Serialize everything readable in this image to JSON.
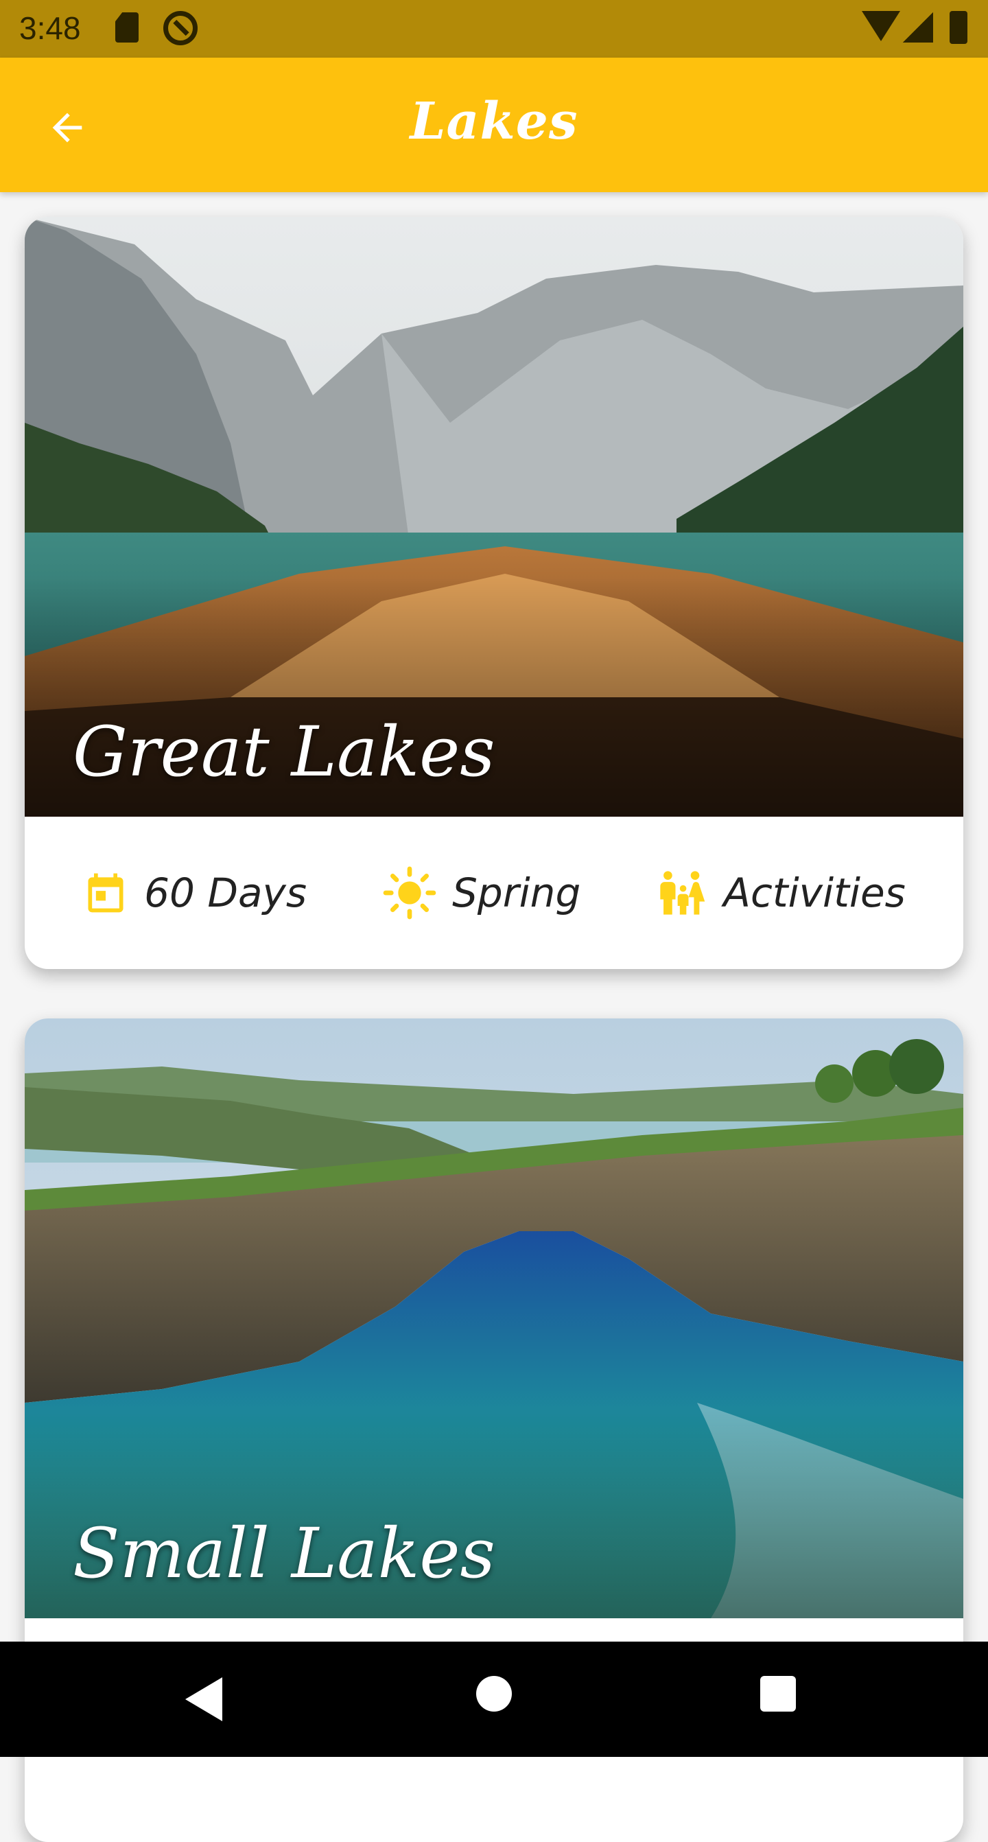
{
  "status_bar": {
    "time": "3:48",
    "icons": [
      "sd-card-icon",
      "at-sign-icon",
      "wifi-icon",
      "signal-icon",
      "battery-icon"
    ]
  },
  "app_bar": {
    "title": "Lakes",
    "back_icon": "arrow-back-icon",
    "background": "#FEC10D"
  },
  "cards": [
    {
      "title": "Great Lakes",
      "image": "boat-on-mountain-lake",
      "info": [
        {
          "icon": "calendar-icon",
          "label": "60 Days"
        },
        {
          "icon": "sun-icon",
          "label": "Spring"
        },
        {
          "icon": "family-icon",
          "label": "Activities"
        }
      ]
    },
    {
      "title": "Small Lakes",
      "image": "sea-arch-lagoon"
    }
  ],
  "accent": "#FEC10D",
  "icon_color": "#FFD31A",
  "nav_bar": {
    "icons": [
      "back-triangle-icon",
      "home-circle-icon",
      "recents-square-icon"
    ]
  }
}
